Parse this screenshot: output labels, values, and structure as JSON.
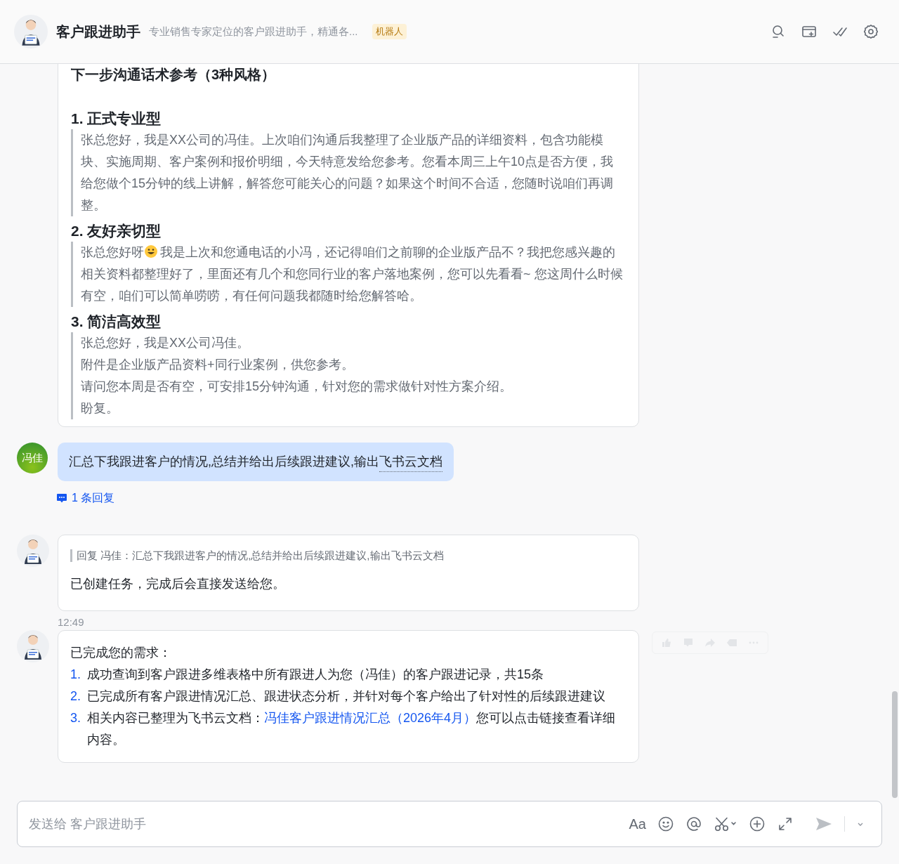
{
  "header": {
    "title": "客户跟进助手",
    "description": "专业销售专家定位的客户跟进助手，精通各...",
    "badge": "机器人"
  },
  "script_card": {
    "heading": "下一步沟通话术参考（3种风格）",
    "styles": [
      {
        "title": "1. 正式专业型",
        "kind": "paragraph",
        "lines": [
          "张总您好，我是XX公司的冯佳。上次咱们沟通后我整理了企业版产品的详细资料，包含功能模块、实施周期、客户案例和报价明细，今天特意发给您参考。您看本周三上午10点是否方便，我给您做个15分钟的线上讲解，解答您可能关心的问题？如果这个时间不合适，您随时说咱们再调整。"
        ]
      },
      {
        "title": "2. 友好亲切型",
        "kind": "emoji_paragraph",
        "lines": [
          "张总您好呀",
          "我是上次和您通电话的小冯，还记得咱们之前聊的企业版产品不？我把您感兴趣的相关资料都整理好了，里面还有几个和您同行业的客户落地案例，您可以先看看~ 您这周什么时候有空，咱们可以简单唠唠，有任何问题我都随时给您解答哈。"
        ]
      },
      {
        "title": "3. 简洁高效型",
        "kind": "lines",
        "lines": [
          "张总您好，我是XX公司冯佳。",
          "附件是企业版产品资料+同行业案例，供您参考。",
          "请问您本周是否有空，可安排15分钟沟通，针对您的需求做针对性方案介绍。",
          "盼复。"
        ]
      }
    ]
  },
  "user_message": {
    "avatar_text": "冯佳",
    "text": "汇总下我跟进客户的情况,总结并给出后续跟进建议,输出",
    "link": "飞书云文档",
    "replies": "1 条回复"
  },
  "reply_message": {
    "quote": "回复 冯佳：汇总下我跟进客户的情况,总结并给出后续跟进建议,输出飞书云文档",
    "text": "已创建任务，完成后会直接发送给您。"
  },
  "timestamp": "12:49",
  "done_message": {
    "intro": "已完成您的需求：",
    "items": [
      {
        "number": "1.",
        "text": "成功查询到客户跟进多维表格中所有跟进人为您（冯佳）的客户跟进记录，共15条"
      },
      {
        "number": "2.",
        "text": "已完成所有客户跟进情况汇总、跟进状态分析，并针对每个客户给出了针对性的后续跟进建议"
      },
      {
        "number": "3.",
        "text": "相关内容已整理为飞书云文档：",
        "link": "冯佳客户跟进情况汇总（2026年4月）",
        "after": "您可以点击链接查看详细内容。"
      }
    ]
  },
  "composer": {
    "placeholder": "发送给 客户跟进助手",
    "format_label": "Aa"
  }
}
